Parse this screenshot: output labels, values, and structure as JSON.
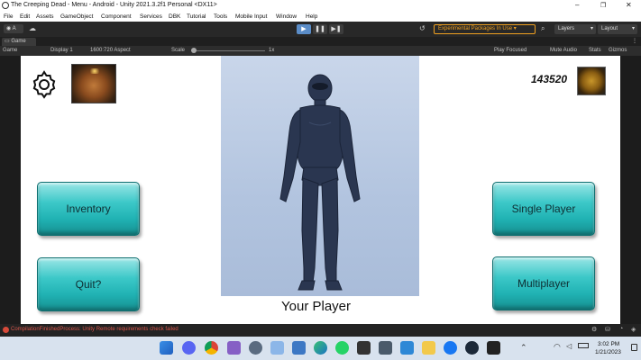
{
  "window": {
    "title": "The Creeping Dead - Menu - Android - Unity 2021.3.2f1 Personal <DX11>",
    "minimize": "–",
    "maximize": "❐",
    "close": "✕"
  },
  "menu": {
    "items": [
      "File",
      "Edit",
      "Assets",
      "GameObject",
      "Component",
      "Services",
      "DBK",
      "Tutorial",
      "Tools",
      "Mobile Input",
      "Window",
      "Help"
    ]
  },
  "toolbar": {
    "account": "A",
    "packages_label": "Experimental Packages In Use",
    "layers": "Layers",
    "layout": "Layout"
  },
  "game_tab": {
    "label": "Game"
  },
  "game_bar": {
    "mode": "Game",
    "display": "Display 1",
    "aspect": "1600:720 Aspect",
    "scale_label": "Scale",
    "scale_value": "1x",
    "play_focused": "Play Focused",
    "mute": "Mute Audio",
    "stats": "Stats",
    "gizmos": "Gizmos"
  },
  "game": {
    "score": "143520",
    "player_caption": "Your Player",
    "buttons": {
      "inventory": "Inventory",
      "quit": "Quit?",
      "single_player": "Single Player",
      "multiplayer": "Multiplayer"
    }
  },
  "status": {
    "error": "CompilationFinishedProcess: Unity Remote requirements check failed"
  },
  "taskbar": {
    "time": "3:02 PM",
    "date": "1/21/2023"
  },
  "colors": {
    "button_teal": "#20b2b3",
    "panel_blue": "#b7c8e2",
    "editor_dark": "#282828",
    "accent_orange": "#f0a020"
  }
}
